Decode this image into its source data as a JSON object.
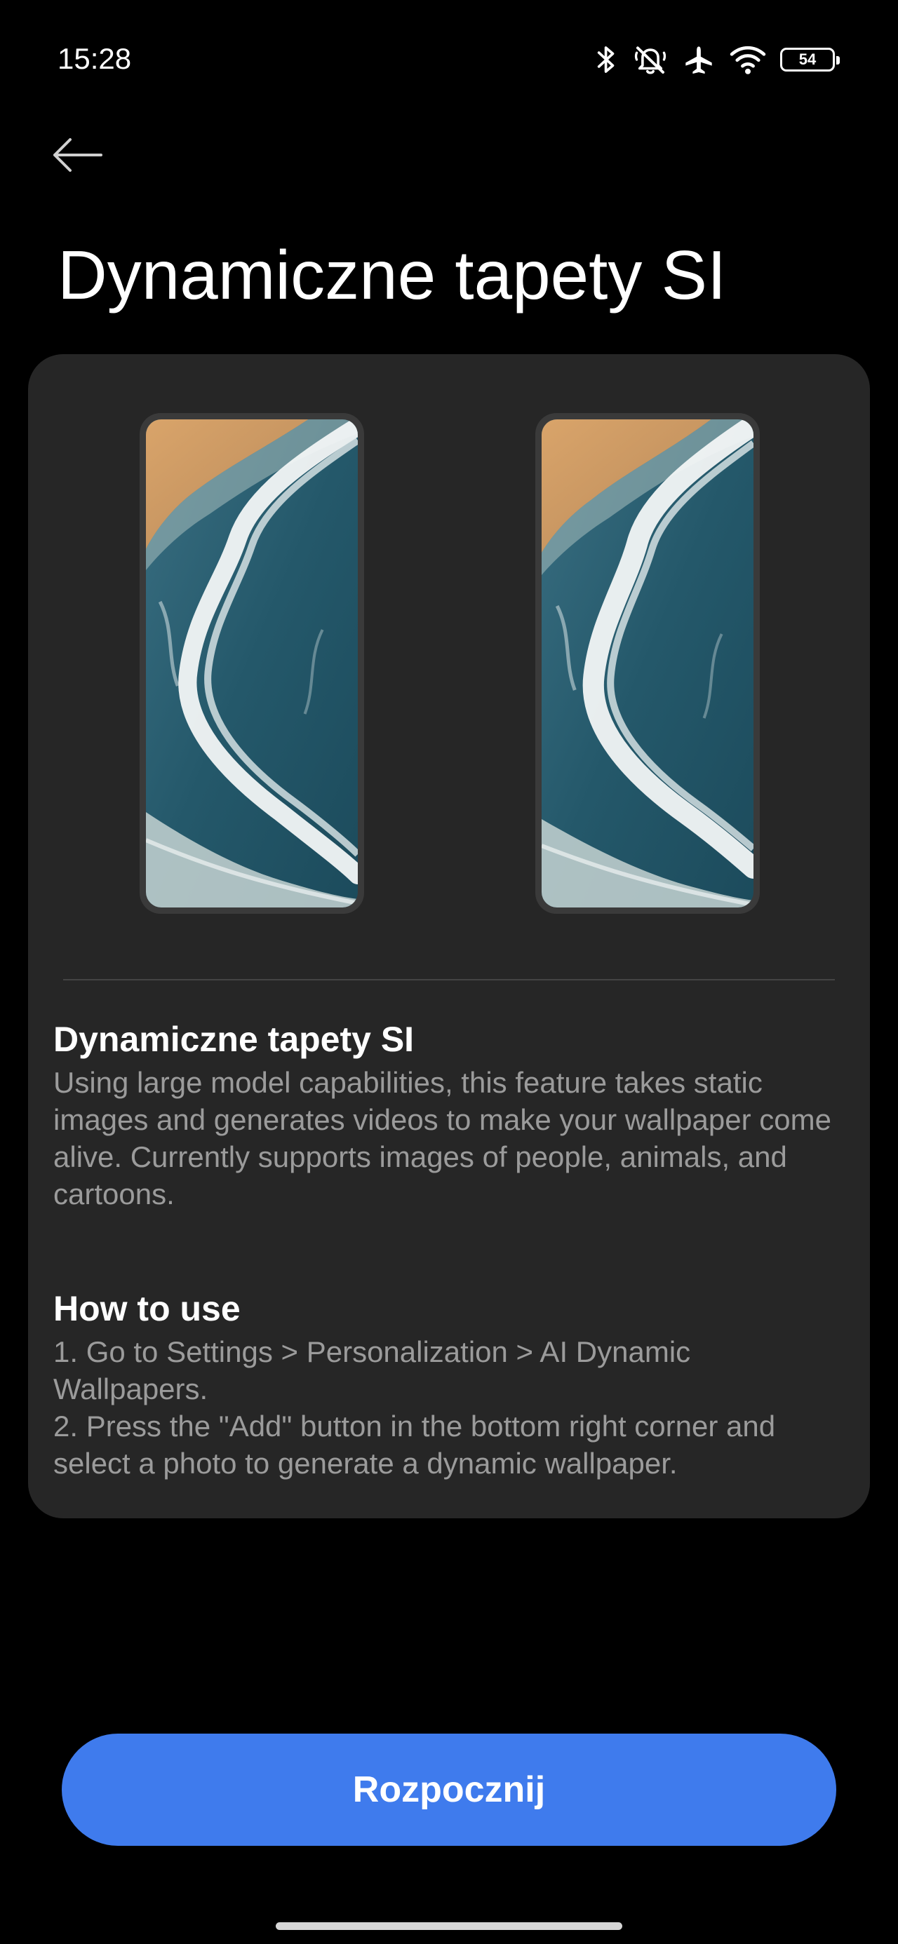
{
  "status_bar": {
    "time": "15:28",
    "battery_level": "54",
    "icons": [
      "bluetooth-icon",
      "silent-bell-icon",
      "airplane-mode-icon",
      "wifi-icon",
      "battery-icon"
    ]
  },
  "header": {
    "back_icon": "arrow-left-icon",
    "title": "Dynamiczne tapety SI"
  },
  "card": {
    "previews": [
      {
        "name": "wallpaper-preview-static",
        "image": "ocean-wave-beach"
      },
      {
        "name": "wallpaper-preview-dynamic",
        "image": "ocean-wave-beach"
      }
    ],
    "feature": {
      "heading": "Dynamiczne tapety SI",
      "description": "Using large model capabilities, this feature takes static images and generates videos to make your wallpaper come alive. Currently supports images of people, animals, and cartoons."
    },
    "how_to_use": {
      "heading": "How to use",
      "steps": [
        "1. Go to Settings > Personalization > AI Dynamic Wallpapers.",
        "2. Press the \"Add\" button in the bottom right corner and select a photo to generate a dynamic wallpaper."
      ]
    }
  },
  "actions": {
    "start_label": "Rozpocznij"
  },
  "colors": {
    "background": "#000000",
    "card": "#262626",
    "accent": "#3f7bed",
    "secondary_text": "#9b9b9b"
  }
}
